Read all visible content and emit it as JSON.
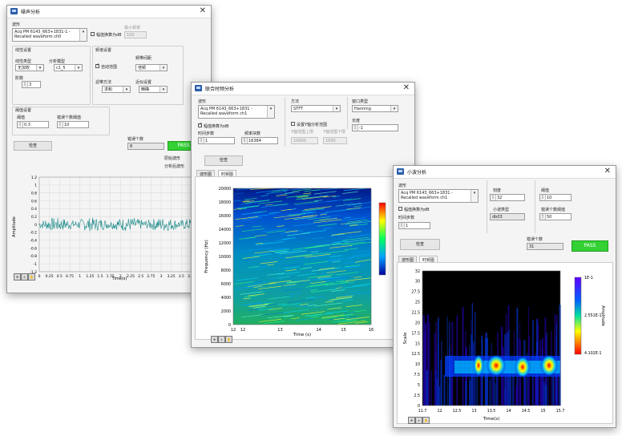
{
  "colors": {
    "wave": "#1b8a8a",
    "pass": "#33d133"
  },
  "w1": {
    "title": "噪声分析",
    "waveform_label": "波形",
    "waveform_value": [
      "Acq PM 6143_663+1831-1 -",
      "Recalled waveform ch0"
    ],
    "db_checkbox": "幅值换算为dB",
    "min_freq_label": "最小频率",
    "min_freq_value": "100",
    "g1_title": "线性设置",
    "line_type_label": "线性类型",
    "line_type_value": "无加权",
    "analysis_label": "分析模型",
    "analysis_value": "c1_5",
    "order_label": "阶数",
    "order_value": "3",
    "g2_title": "频谱设置",
    "auto_cb": "自动范围",
    "band_label": "频带间距",
    "band_value": "倍频",
    "method_label": "滤带方法",
    "method_value": "求和",
    "extra_label": "近似设置",
    "extra_value": "精确",
    "g3_title": "阈值设置",
    "threshold_label": "阈值",
    "threshold_value": "0.3",
    "error_points_label": "错误个数阈值",
    "error_points_value": "10",
    "check_btn": "检查",
    "error_count_label": "错误个数",
    "error_count_value": "8",
    "pass": "PASS",
    "legend1": "原始波形",
    "legend2": "分析后波形",
    "ylabel": "Amplitude",
    "xlabel": "Time(s)",
    "yticks": [
      "1.2",
      "1",
      "0.8",
      "0.6",
      "0.4",
      "0.2",
      "0",
      "-0.2",
      "-0.4",
      "-0.6",
      "-0.8",
      "-1",
      "-1.2"
    ],
    "xticks": [
      "0",
      "0.25",
      "0.5",
      "0.75",
      "1",
      "1.25",
      "1.5",
      "1.75",
      "2",
      "2.25",
      "2.5",
      "2.75",
      "3",
      "3.25",
      "3.5",
      "3.75"
    ]
  },
  "w2": {
    "title": "联合时频分析",
    "waveform_label": "波形",
    "waveform_value": [
      "Acq PM 6143_663+1831 -",
      "Recalled waveform ch1"
    ],
    "db_checkbox": "幅值换算为dB",
    "method_label": "方法",
    "method_value": "STFT",
    "window_label": "窗口类型",
    "window_value": "Hanning",
    "time_steps_label": "时间步数",
    "time_steps_value": "1",
    "freq_bins_label": "频率块数",
    "freq_bins_value": "16384",
    "freq_range_cb": "设置Y轴分析范围",
    "y_upper_label": "Y轴范围上限",
    "y_lower_label": "Y轴范围下限",
    "y_upper_value": "10000",
    "y_lower_value": "1000",
    "length_label": "长度",
    "length_value": "-1",
    "check_btn": "检查",
    "tabs": [
      "波形图",
      "时频图"
    ],
    "ylabel": "Frequency (Hz)",
    "xlabel": "Time (s)",
    "yticks": [
      "20000",
      "18000",
      "16000",
      "14000",
      "12000",
      "10000",
      "8000",
      "6000",
      "4000",
      "2000",
      "0"
    ],
    "xticks": [
      "12",
      "12",
      "13",
      "14",
      "15",
      "16"
    ]
  },
  "w3": {
    "title": "小波分析",
    "waveform_label": "波形",
    "waveform_value": [
      "Acq PM 6143_663+1831 -",
      "Recalled waveform ch1"
    ],
    "db_checkbox": "幅值换算为dB",
    "steps_label": "时间步数",
    "steps_value": "1",
    "scale_label": "刻度",
    "scale_value": "32",
    "wavelet_label": "小波类型",
    "wavelet_value": "db03",
    "threshold_label": "阈值",
    "threshold_value": "10",
    "error_points_label": "错误个数阈值",
    "error_points_value": "50",
    "check_btn": "检查",
    "error_count_label": "错误个数",
    "error_count_value": "31",
    "pass": "PASS",
    "tabs": [
      "波形图",
      "时频图"
    ],
    "ylabel": "Scale",
    "xlabel": "Time(s)",
    "cbar_label": "Amplitude",
    "cbar_ticks": [
      "1E-1",
      "2.551E-1",
      "4.102E-1"
    ],
    "yticks": [
      "32",
      "30",
      "27.5",
      "25",
      "22.5",
      "20",
      "17.5",
      "15",
      "12.5",
      "10",
      "7.5",
      "5",
      "2.5",
      "0"
    ],
    "xticks": [
      "11.7",
      "12",
      "12.5",
      "13",
      "13.5",
      "14",
      "14.5",
      "15",
      "15.7"
    ]
  }
}
